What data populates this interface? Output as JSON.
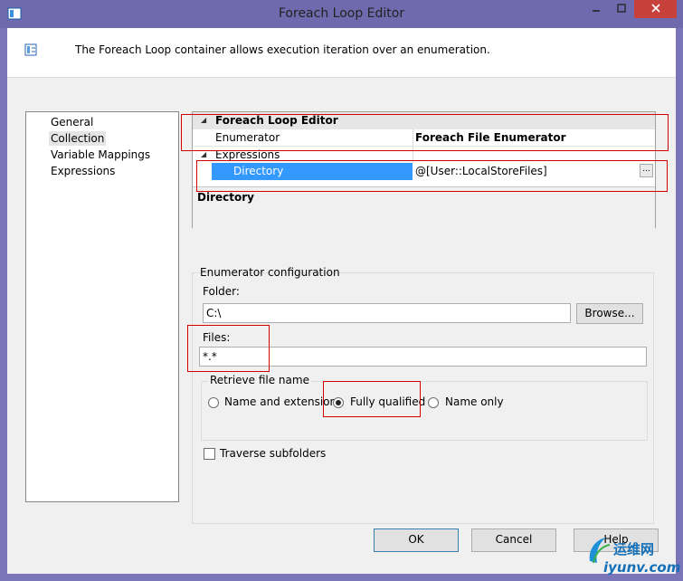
{
  "window": {
    "title": "Foreach Loop Editor"
  },
  "header": {
    "description": "The Foreach Loop container allows execution iteration over an enumeration."
  },
  "nav": {
    "items": [
      {
        "label": "General"
      },
      {
        "label": "Collection"
      },
      {
        "label": "Variable Mappings"
      },
      {
        "label": "Expressions"
      }
    ]
  },
  "grid": {
    "category_editor": "Foreach Loop Editor",
    "enumerator_label": "Enumerator",
    "enumerator_value": "Foreach File Enumerator",
    "category_expressions": "Expressions",
    "directory_label": "Directory",
    "directory_value": "@[User::LocalStoreFiles]",
    "ellipsis": "...",
    "description_title": "Directory"
  },
  "config": {
    "group_title": "Enumerator configuration",
    "folder_label": "Folder:",
    "folder_value": "C:\\",
    "browse_label": "Browse...",
    "files_label": "Files:",
    "files_value": "*.*",
    "retrieve_title": "Retrieve file name",
    "options": [
      {
        "label": "Name and extension",
        "selected": false
      },
      {
        "label": "Fully qualified",
        "selected": true
      },
      {
        "label": "Name only",
        "selected": false
      }
    ],
    "traverse_label": "Traverse subfolders",
    "traverse_checked": false
  },
  "buttons": {
    "ok": "OK",
    "cancel": "Cancel",
    "help": "Help"
  },
  "watermark": {
    "text": "运维网",
    "url": "iyunv.com"
  },
  "colors": {
    "annotation_red": "#d40000",
    "selection_blue": "#3399ff",
    "close_red": "#c7413a"
  }
}
